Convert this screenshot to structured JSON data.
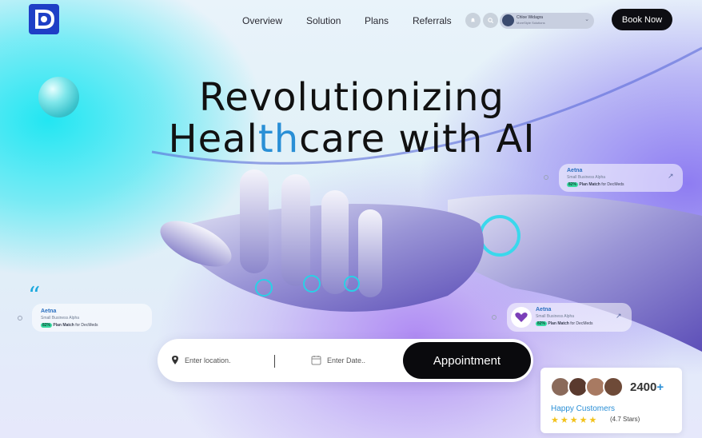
{
  "nav": {
    "links": [
      "Overview",
      "Solution",
      "Plans",
      "Referrals"
    ],
    "user": {
      "name": "Chloe Widagra",
      "subtitle": "MoreStyle Solutions"
    },
    "book_label": "Book Now"
  },
  "hero": {
    "headline_line1": "Revolutionizing",
    "headline_line2_pre": "Heal",
    "headline_line2_accent": "th",
    "headline_line2_post": "care with AI"
  },
  "cards": [
    {
      "title": "Aetna",
      "subtitle": "Small Business Alpha",
      "pct": "82%",
      "match_bold": "Plan Match",
      "match_rest": " for DecMeds"
    },
    {
      "title": "Aetna",
      "subtitle": "Small Business Alpha",
      "pct": "82%",
      "match_bold": "Plan Match",
      "match_rest": " for DecMeds"
    },
    {
      "title": "Aetna",
      "subtitle": "Small Business Alpha",
      "pct": "82%",
      "match_bold": "Plan Match",
      "match_rest": " for DecMeds"
    }
  ],
  "search": {
    "location_placeholder": "Enter location.",
    "date_placeholder": "Enter Date..",
    "appointment_label": "Appointment"
  },
  "customers": {
    "count": "2400",
    "plus": "+",
    "label": "Happy Customers",
    "stars": "★★★★★",
    "rating_text": "(4.7 Stars)",
    "rating_value": 4.7
  },
  "colors": {
    "accent": "#2a8fd6",
    "brand": "#1e3fc6",
    "button_dark": "#0d0d12"
  },
  "icons": [
    "logo-icon",
    "bell-icon",
    "search-icon",
    "chevron-down-icon",
    "quote-icon",
    "location-pin-icon",
    "calendar-icon",
    "heart-icon",
    "arrow-up-right-icon",
    "star-icon"
  ]
}
